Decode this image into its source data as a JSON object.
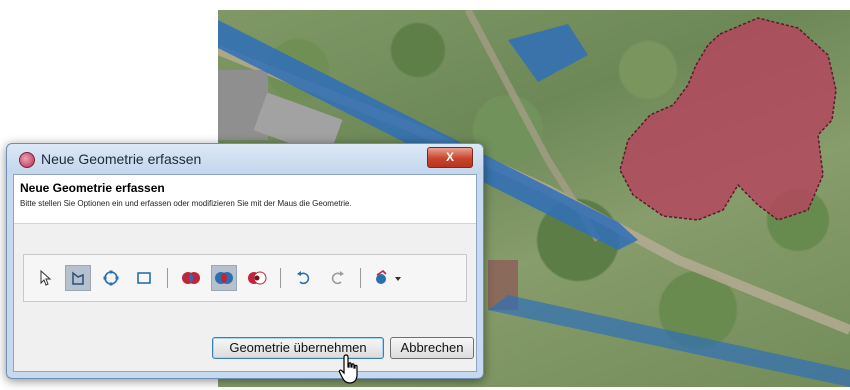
{
  "dialog": {
    "window_title": "Neue Geometrie erfassen",
    "close_label": "X",
    "header_title": "Neue Geometrie erfassen",
    "header_description": "Bitte stellen Sie Optionen ein und erfassen oder modifizieren Sie mit der Maus die Geometrie.",
    "tools": [
      {
        "name": "select-arrow-icon",
        "active": false
      },
      {
        "name": "draw-polygon-icon",
        "active": true
      },
      {
        "name": "draw-circle-icon",
        "active": false
      },
      {
        "name": "draw-rectangle-icon",
        "active": false
      },
      {
        "name": "geometry-union-icon",
        "active": false
      },
      {
        "name": "geometry-intersect-icon",
        "active": true
      },
      {
        "name": "geometry-subtract-icon",
        "active": false
      },
      {
        "name": "undo-icon",
        "active": false
      },
      {
        "name": "redo-icon",
        "active": false
      },
      {
        "name": "snap-options-icon",
        "active": false
      }
    ],
    "apply_button": "Geometrie übernehmen",
    "cancel_button": "Abbrechen"
  },
  "colors": {
    "polygon_fill": "#b3485e",
    "road_blue": "#2f6fb8",
    "title_bar": "#c7d9ee",
    "close_red": "#c8452c"
  }
}
